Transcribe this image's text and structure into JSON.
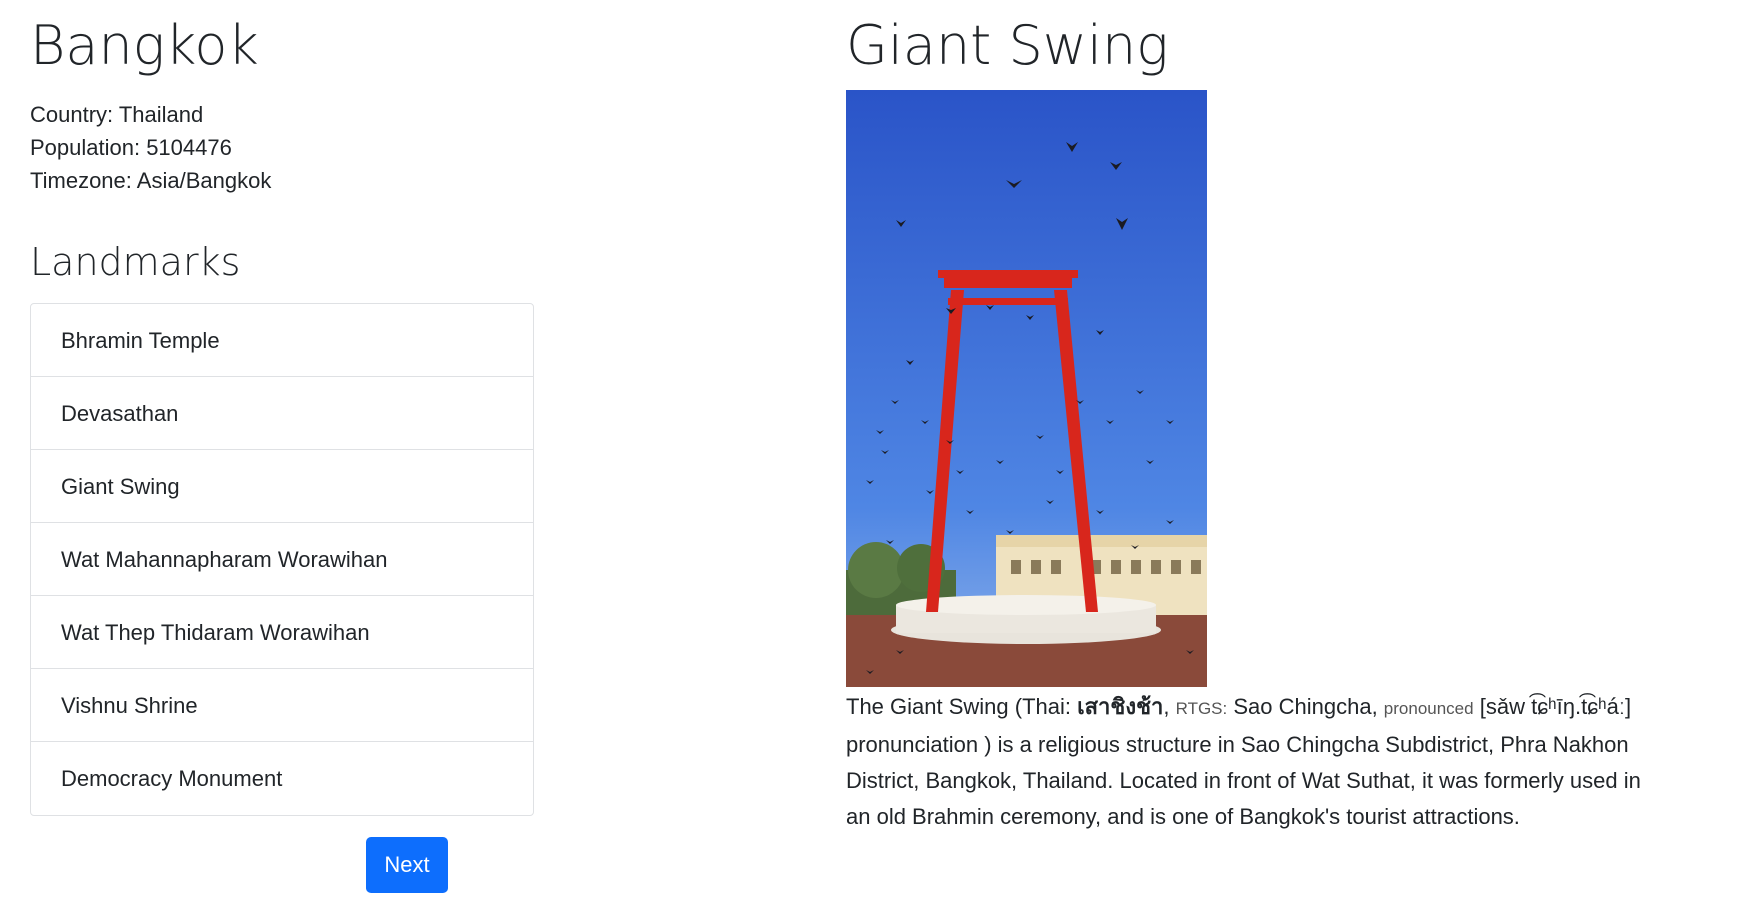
{
  "city": {
    "name": "Bangkok",
    "country_line": "Country: Thailand",
    "population_line": "Population: 5104476",
    "timezone_line": "Timezone: Asia/Bangkok"
  },
  "landmarks": {
    "heading": "Landmarks",
    "items": [
      {
        "label": "Bhramin Temple"
      },
      {
        "label": "Devasathan"
      },
      {
        "label": "Giant Swing"
      },
      {
        "label": "Wat Mahannapharam Worawihan"
      },
      {
        "label": "Wat Thep Thidaram Worawihan"
      },
      {
        "label": "Vishnu Shrine"
      },
      {
        "label": "Democracy Monument"
      }
    ],
    "next_label": "Next"
  },
  "detail": {
    "title": "Giant Swing",
    "image_name": "giant-swing-photo",
    "desc": {
      "p1": "The Giant Swing (Thai: ",
      "thai": "เสาชิงช้า",
      "p2": ", ",
      "rtgs": "RTGS:",
      "p3": " Sao Chingcha, ",
      "pronounced": "pronounced",
      "ipa": " [sǎw t͡ɕʰīŋ.t͡ɕʰáː]",
      "p4": " pronunciation ) is a religious structure in Sao Chingcha Subdistrict, Phra Nakhon District, Bangkok, Thailand. Located in front of Wat Suthat, it was formerly used in an old Brahmin ceremony, and is one of Bangkok's tourist attractions."
    }
  },
  "colors": {
    "button": "#0d6efd",
    "swing": "#d8261c",
    "sky_top": "#2f5fd0",
    "sky_bottom": "#5c93ea"
  }
}
